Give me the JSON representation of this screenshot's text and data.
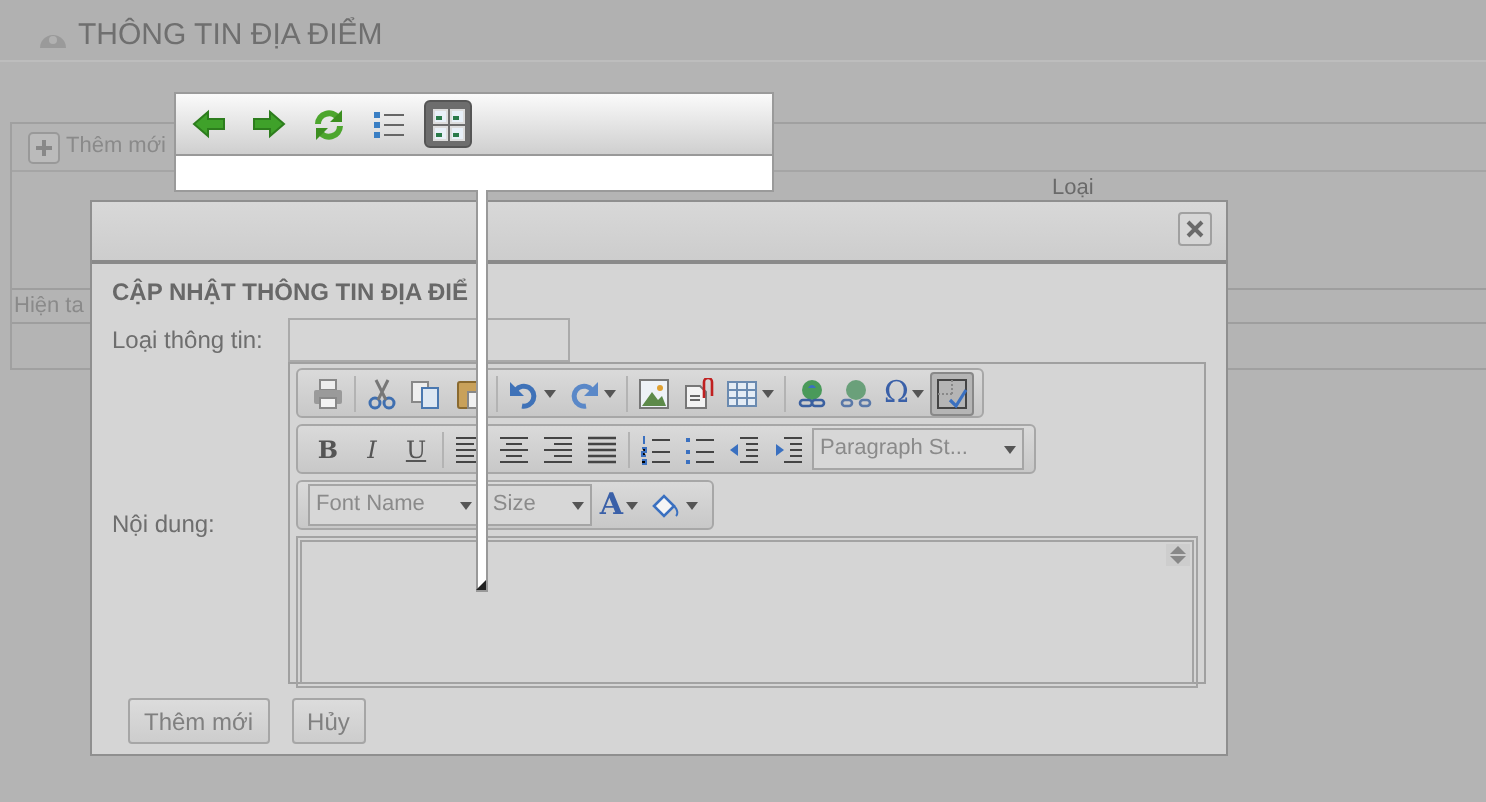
{
  "page": {
    "title": "THÔNG TIN ĐỊA ĐIỂM",
    "add_button": "Thêm mới",
    "column_header": "Loại",
    "footer_text": "Hiện ta"
  },
  "view_toolbar": {
    "buttons": [
      {
        "kind": "back",
        "selected": false
      },
      {
        "kind": "forward",
        "selected": false
      },
      {
        "kind": "refresh",
        "selected": false
      },
      {
        "kind": "list",
        "selected": false
      },
      {
        "kind": "grid",
        "selected": true
      }
    ]
  },
  "dialog": {
    "title": "CẬP NHẬT THÔNG TIN ĐỊA ĐIỂ",
    "type_field": {
      "label": "Loại thông tin:"
    },
    "content_field": {
      "label": "Nội dung:"
    },
    "editor": {
      "rows": [
        [
          [
            {
              "kind": "print"
            }
          ],
          [
            {
              "kind": "cut"
            },
            {
              "kind": "copy"
            },
            {
              "kind": "paste"
            }
          ],
          [
            {
              "kind": "undo",
              "dropdown": true
            },
            {
              "kind": "redo",
              "dropdown": true
            }
          ],
          [
            {
              "kind": "image"
            },
            {
              "kind": "attach"
            },
            {
              "kind": "table",
              "dropdown": true
            }
          ],
          [
            {
              "kind": "link"
            },
            {
              "kind": "unlink"
            },
            {
              "kind": "symbol",
              "label": "Ω",
              "dropdown": true
            },
            {
              "kind": "blocks",
              "selected": true
            }
          ]
        ],
        [
          [
            {
              "kind": "bold",
              "label": "B"
            },
            {
              "kind": "italic",
              "label": "I"
            },
            {
              "kind": "underline",
              "label": "U"
            }
          ],
          [
            {
              "kind": "align-left"
            },
            {
              "kind": "align-center"
            },
            {
              "kind": "align-right"
            },
            {
              "kind": "justify"
            }
          ],
          [
            {
              "kind": "ordered-list"
            },
            {
              "kind": "bullet-list"
            },
            {
              "kind": "outdent"
            },
            {
              "kind": "indent"
            },
            {
              "kind": "combo",
              "label": "Paragraph St..."
            }
          ]
        ],
        [
          [
            {
              "kind": "combo",
              "label": "Font Name"
            },
            {
              "kind": "combo",
              "label": "Size"
            },
            {
              "kind": "font-color",
              "label": "A",
              "dropdown": true
            },
            {
              "kind": "fill",
              "dropdown": true
            }
          ]
        ]
      ]
    },
    "buttons": [
      "Thêm mới",
      "Hủy"
    ]
  }
}
